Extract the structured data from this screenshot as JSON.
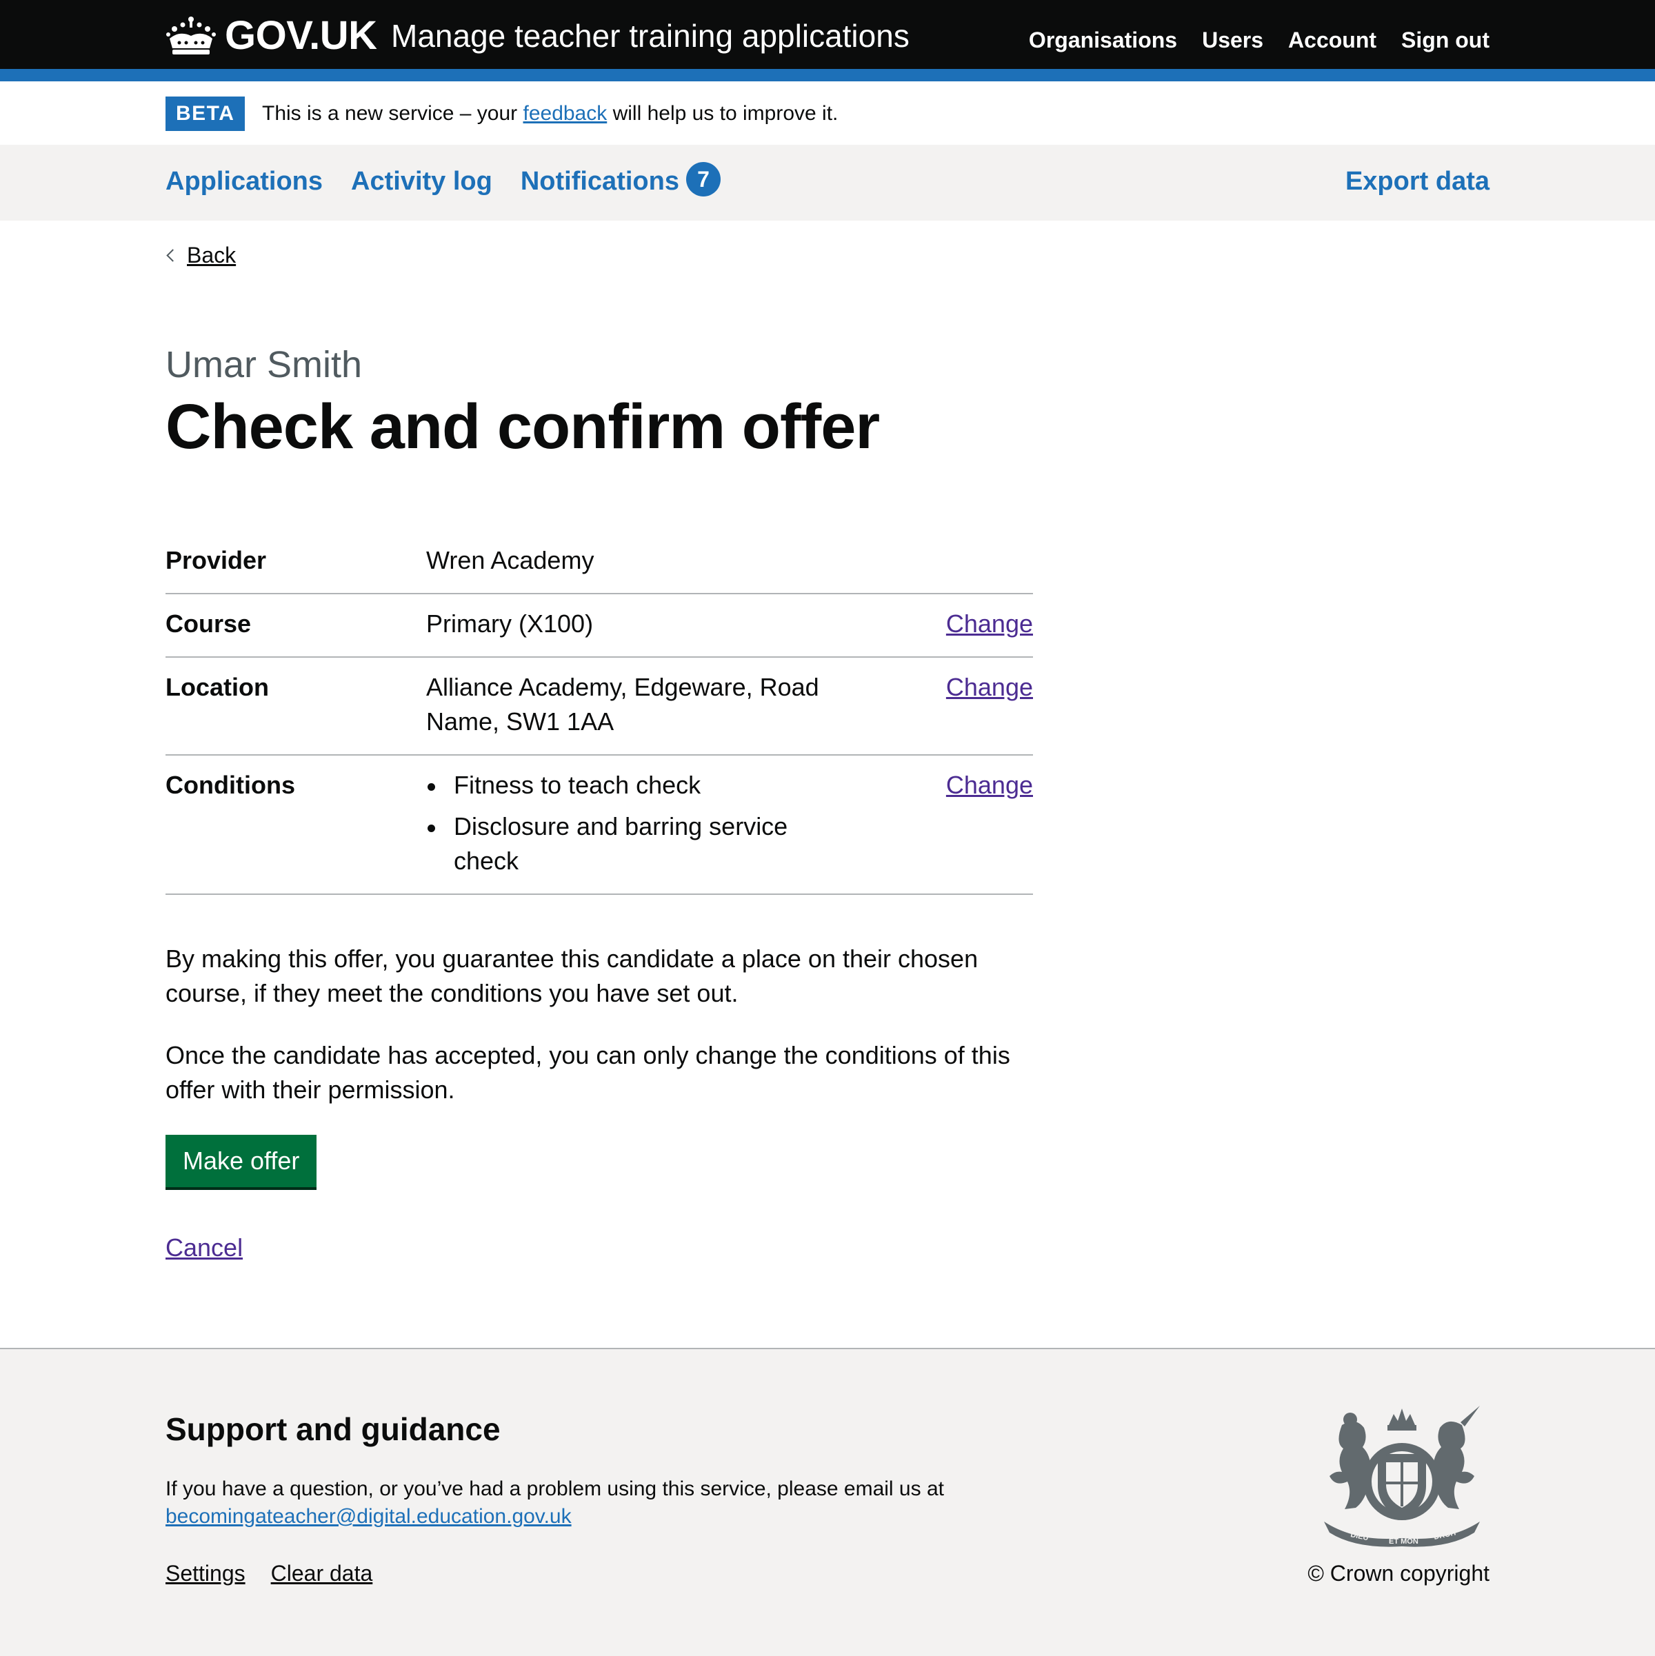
{
  "header": {
    "logo_text": "GOV.UK",
    "service_name": "Manage teacher training applications",
    "nav": [
      "Organisations",
      "Users",
      "Account",
      "Sign out"
    ]
  },
  "phase_banner": {
    "tag": "BETA",
    "text_before": "This is a new service – your ",
    "link": "feedback",
    "text_after": " will help us to improve it."
  },
  "primary_nav": {
    "items": [
      "Applications",
      "Activity log",
      "Notifications"
    ],
    "notifications_count": "7",
    "export": "Export data"
  },
  "back_link": "Back",
  "caption": "Umar Smith",
  "title": "Check and confirm offer",
  "summary": {
    "rows": [
      {
        "key": "Provider",
        "value": "Wren Academy",
        "action": ""
      },
      {
        "key": "Course",
        "value": "Primary (X100)",
        "action": "Change"
      },
      {
        "key": "Location",
        "value": "Alliance Academy, Edgeware, Road Name, SW1 1AA",
        "action": "Change"
      },
      {
        "key": "Conditions",
        "conditions": [
          "Fitness to teach check",
          "Disclosure and barring service check"
        ],
        "action": "Change"
      }
    ]
  },
  "paragraphs": [
    "By making this offer, you guarantee this candidate a place on their chosen course, if they meet the conditions you have set out.",
    "Once the candidate has accepted, you can only change the conditions of this offer with their permission."
  ],
  "make_offer_button": "Make offer",
  "cancel_link": "Cancel",
  "footer": {
    "heading": "Support and guidance",
    "text": "If you have a question, or you’ve had a problem using this service, please email us at",
    "email": "becomingateacher@digital.education.gov.uk",
    "links": [
      "Settings",
      "Clear data"
    ],
    "copyright": "© Crown copyright",
    "crest_text": [
      "DIEU",
      "ET MON",
      "DROIT"
    ]
  },
  "colors": {
    "header_bg": "#0b0c0c",
    "brand_blue": "#1d70b8",
    "button_green": "#00703c",
    "visited_link": "#4c2c92",
    "footer_bg": "#f3f2f1"
  },
  "icons": [
    "crown-icon",
    "chevron-left-icon",
    "royal-coat-of-arms-icon"
  ]
}
